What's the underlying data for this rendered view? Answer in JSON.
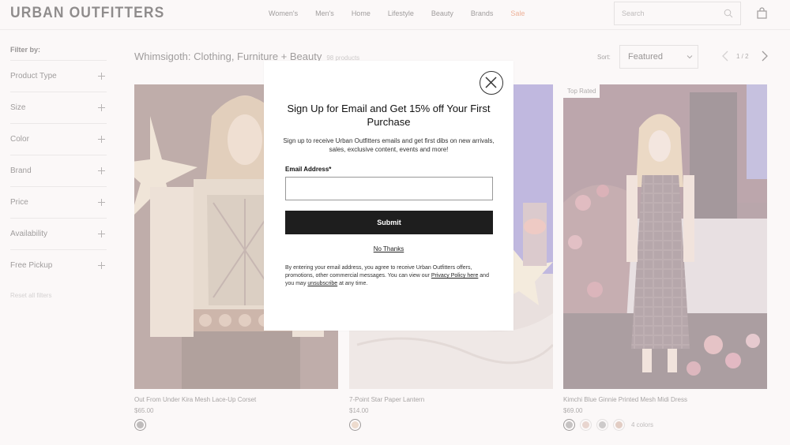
{
  "header": {
    "logo": "URBAN OUTFITTERS",
    "nav": [
      "Women's",
      "Men's",
      "Home",
      "Lifestyle",
      "Beauty",
      "Brands",
      "Sale"
    ],
    "search_placeholder": "Search",
    "sale_color": "#e0612a"
  },
  "sidebar": {
    "title": "Filter by:",
    "filters": [
      "Product Type",
      "Size",
      "Color",
      "Brand",
      "Price",
      "Availability",
      "Free Pickup"
    ],
    "reset": "Reset all filters"
  },
  "main": {
    "title": "Whimsigoth: Clothing, Furniture + Beauty",
    "count": "98 products",
    "sort_label": "Sort:",
    "sort_value": "Featured",
    "pager": "1 / 2"
  },
  "products": [
    {
      "name": "Out From Under Kira Mesh Lace-Up Corset",
      "price": "$65.00",
      "badge": "",
      "swatches": [
        "#7a7a7a"
      ],
      "more": ""
    },
    {
      "name": "7-Point Star Paper Lantern",
      "price": "$14.00",
      "badge": "",
      "swatches": [
        "#e0bfa2"
      ],
      "more": ""
    },
    {
      "name": "Kimchi Blue Ginnie Printed Mesh Midi Dress",
      "price": "$69.00",
      "badge": "Top Rated",
      "swatches": [
        "#8a8a8a",
        "#d6b3a4",
        "#9a9a9a",
        "#c9a08c"
      ],
      "more": "4 colors"
    }
  ],
  "modal": {
    "heading": "Sign Up for Email and Get 15% off Your First Purchase",
    "subtext": "Sign up to receive Urban Outfitters emails and get first dibs on new arrivals, sales, exclusive content, events and more!",
    "email_label": "Email Address*",
    "submit": "Submit",
    "no_thanks": "No Thanks",
    "legal_1": "By entering your email address, you agree to receive Urban Outfitters offers, promotions, other commercial messages. You can view our ",
    "privacy_link": "Privacy Policy here",
    "legal_2": " and you may ",
    "unsubscribe_link": "unsubscribe",
    "legal_3": " at any time."
  }
}
